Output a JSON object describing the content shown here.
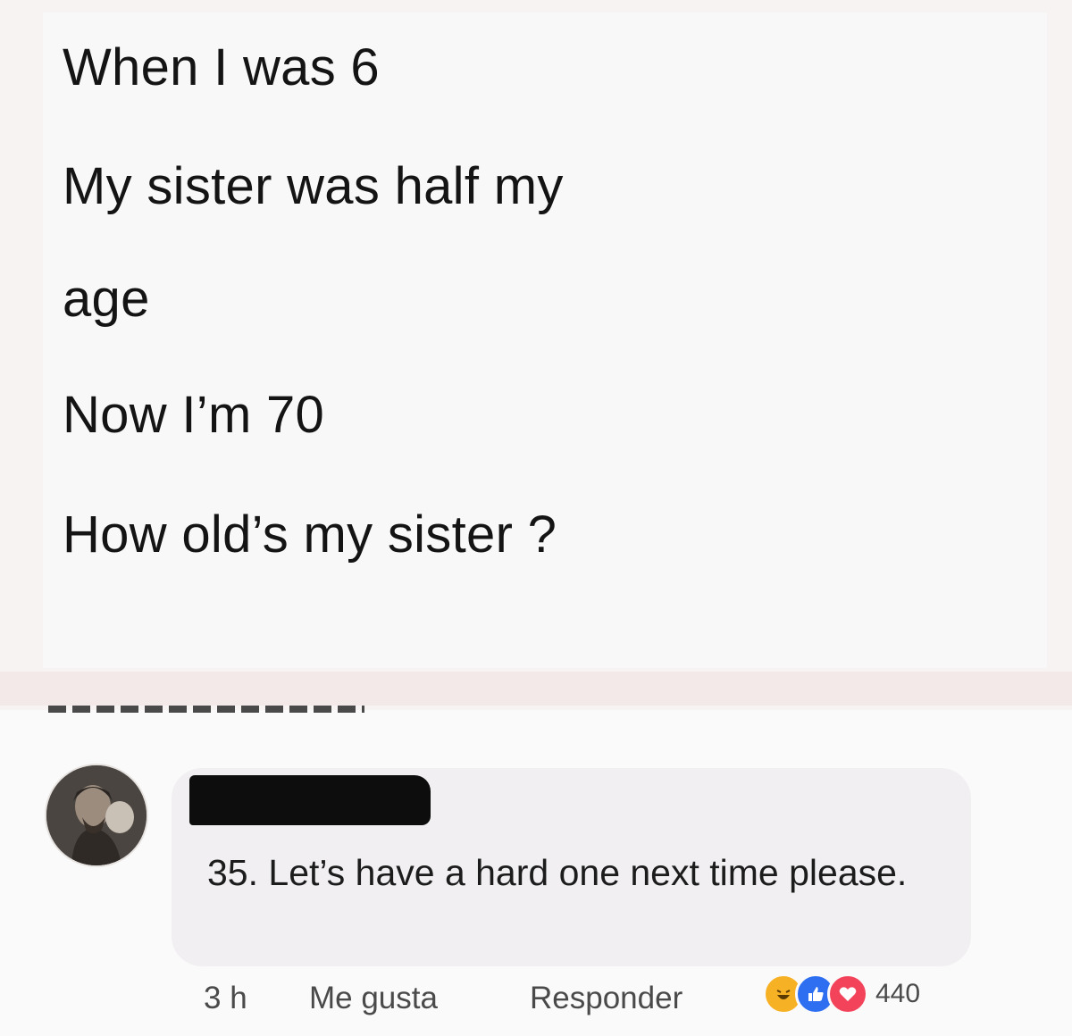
{
  "post": {
    "lines": [
      "When I was 6",
      "My sister was half my",
      "age",
      "Now I’m 70",
      "How old’s my sister ?"
    ]
  },
  "comment": {
    "text": "35. Let’s have a hard one next time please.",
    "time": "3 h",
    "like_label": "Me gusta",
    "reply_label": "Responder",
    "reaction_count": "440",
    "reactions": [
      "haha-icon",
      "like-icon",
      "love-icon"
    ]
  },
  "colors": {
    "haha": "#f7b125",
    "like": "#2d6ff0",
    "love": "#f2435a"
  }
}
